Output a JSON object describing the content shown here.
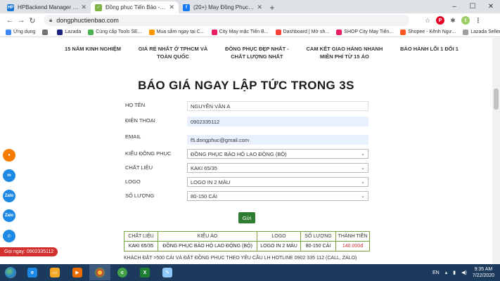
{
  "browser": {
    "tabs": [
      {
        "label": "HPBackend Manager by TanLCFE",
        "icon": "HP",
        "color": "#1976d2",
        "active": false
      },
      {
        "label": "Đồng phục Tiến Bảo - Xưởng may",
        "icon": "✓",
        "color": "#7cb342",
        "active": true
      },
      {
        "label": "(20+) May Đồng Phục | Faceboo",
        "icon": "f",
        "color": "#1877f2",
        "active": false
      }
    ],
    "new_tab": "+",
    "url": "dongphuctienbao.com",
    "bookmarks": [
      {
        "label": "Ứng dụng",
        "color": "#4285f4"
      },
      {
        "label": "",
        "color": "#757575"
      },
      {
        "label": "Lazada",
        "color": "#1a237e"
      },
      {
        "label": "Cùng cấp Tools SE...",
        "color": "#4caf50"
      },
      {
        "label": "Mua sắm ngay tại C...",
        "color": "#ff9800"
      },
      {
        "label": "City May mặc Tiến B...",
        "color": "#e91e63"
      },
      {
        "label": "Dashboard | Mở sh...",
        "color": "#f44336"
      },
      {
        "label": "SHOP City May Tiến...",
        "color": "#e91e63"
      },
      {
        "label": "Shopee - Kênh Ngư...",
        "color": "#ff5722"
      },
      {
        "label": "Lazada Seller Center",
        "color": "#9e9e9e"
      }
    ]
  },
  "features": [
    [
      "15 NĂM KINH NGHIỆM",
      ""
    ],
    [
      "GIÁ RẺ NHẤT Ở TPHCM VÀ",
      "TOÀN QUỐC"
    ],
    [
      "ĐỒNG PHỤC ĐẸP NHẤT -",
      "CHẤT LƯỢNG NHẤT"
    ],
    [
      "CAM KẾT GIAO HÀNG NHANH",
      "MIỄN PHÍ TỪ 15 ÁO"
    ],
    [
      "BẢO HÀNH LỖI 1 ĐỔI 1",
      ""
    ]
  ],
  "heading": "BÁO GIÁ NGAY LẬP TỨC TRONG 3S",
  "form": {
    "name_label": "HỌ TÊN",
    "name_value": "NGUYỄN VĂN A",
    "phone_label": "ĐIỆN THOẠI",
    "phone_value": "0902335112",
    "email_label": "EMAIL",
    "email_value": "f5.dongphuc@gmail.com",
    "type_label": "KIỂU ĐỒNG PHỤC",
    "type_value": "ĐỒNG PHỤC BẢO HỘ LAO ĐỘNG (BỘ)",
    "material_label": "CHẤT LIỆU",
    "material_value": "KAKI 65/35",
    "logo_label": "LOGO",
    "logo_value": "LOGO IN 2 MÀU",
    "qty_label": "SỐ LƯỢNG",
    "qty_value": "80-150 CÁI",
    "submit_label": "Gửi"
  },
  "result_table": {
    "headers": [
      "CHẤT LIỆU",
      "KIỂU ÁO",
      "LOGO",
      "SỐ LƯỢNG",
      "THÀNH TIỀN"
    ],
    "row": [
      "KAKI 65/35",
      "ĐỒNG PHỤC BẢO HỘ LAO ĐỘNG (BỘ)",
      "LOGO IN 2 MÀU",
      "80-150 CÁI",
      "140.000đ"
    ]
  },
  "note": "KHÁCH ĐẶT >500 CÁI VÀ ĐẶT ĐỒNG PHỤC THEO YÊU CẦU LH HOTLINE 0902 335 112 (CALL, ZALO)",
  "floaters": [
    {
      "name": "map-pin-icon",
      "glyph": "●",
      "color": "#f57c00"
    },
    {
      "name": "messenger-icon",
      "glyph": "m",
      "color": "#1e88e5"
    },
    {
      "name": "zalo-icon",
      "glyph": "Zalo",
      "color": "#1e88e5"
    },
    {
      "name": "zalo-icon-2",
      "glyph": "Zalo",
      "color": "#1e88e5"
    },
    {
      "name": "phone-icon",
      "glyph": "✆",
      "color": "#1e88e5"
    }
  ],
  "call_now": "Gọi ngay: 0902335112",
  "taskbar": {
    "lang": "EN",
    "time": "9:35 AM",
    "date": "7/22/2020"
  }
}
